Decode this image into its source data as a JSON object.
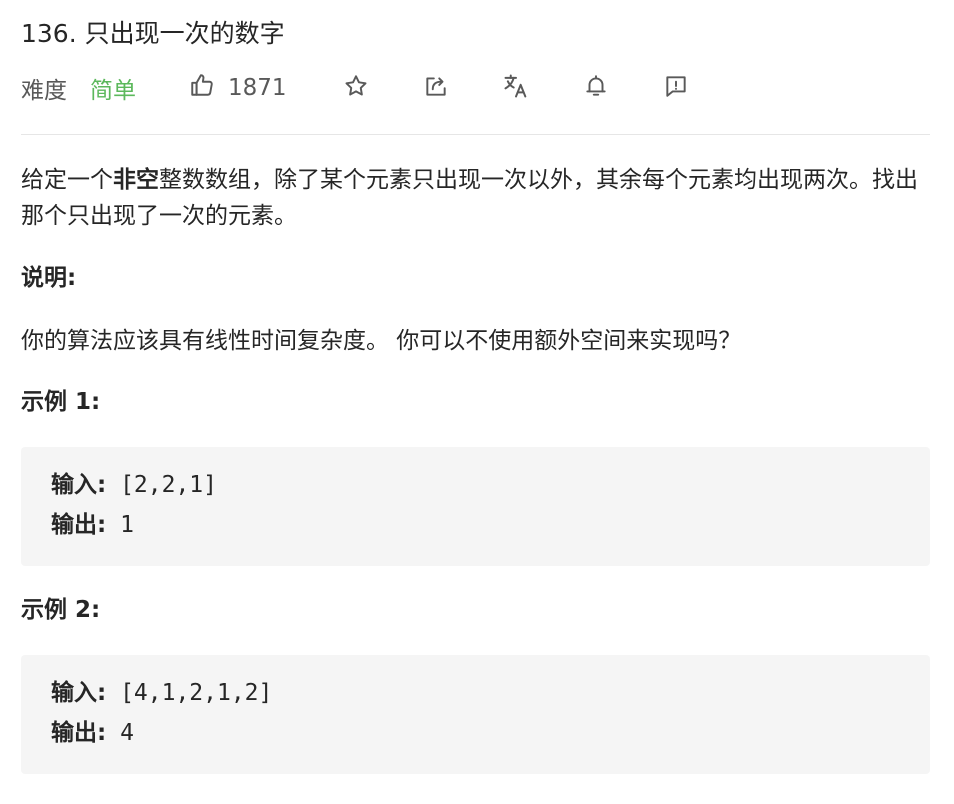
{
  "problem": {
    "title": "136. 只出现一次的数字",
    "difficulty_label": "难度",
    "difficulty_value": "简单",
    "likes": "1871"
  },
  "toolbar_icons": [
    "thumbs-up-icon",
    "star-icon",
    "share-icon",
    "translate-icon",
    "bell-icon",
    "feedback-icon"
  ],
  "colors": {
    "difficulty_easy": "#5cb85c",
    "text": "#262626",
    "muted": "#595959",
    "code_bg": "#f5f5f5"
  },
  "description": {
    "part1": "给定一个",
    "bold": "非空",
    "part2": "整数数组，除了某个元素只出现一次以外，其余每个元素均出现两次。找出那个只出现了一次的元素。"
  },
  "note": {
    "label": "说明:",
    "text": "你的算法应该具有线性时间复杂度。 你可以不使用额外空间来实现吗？"
  },
  "examples": [
    {
      "title": "示例 1:",
      "input_label": "输入:",
      "input": "[2,2,1]",
      "output_label": "输出:",
      "output": "1"
    },
    {
      "title": "示例 2:",
      "input_label": "输入:",
      "input": "[4,1,2,1,2]",
      "output_label": "输出:",
      "output": "4"
    }
  ]
}
